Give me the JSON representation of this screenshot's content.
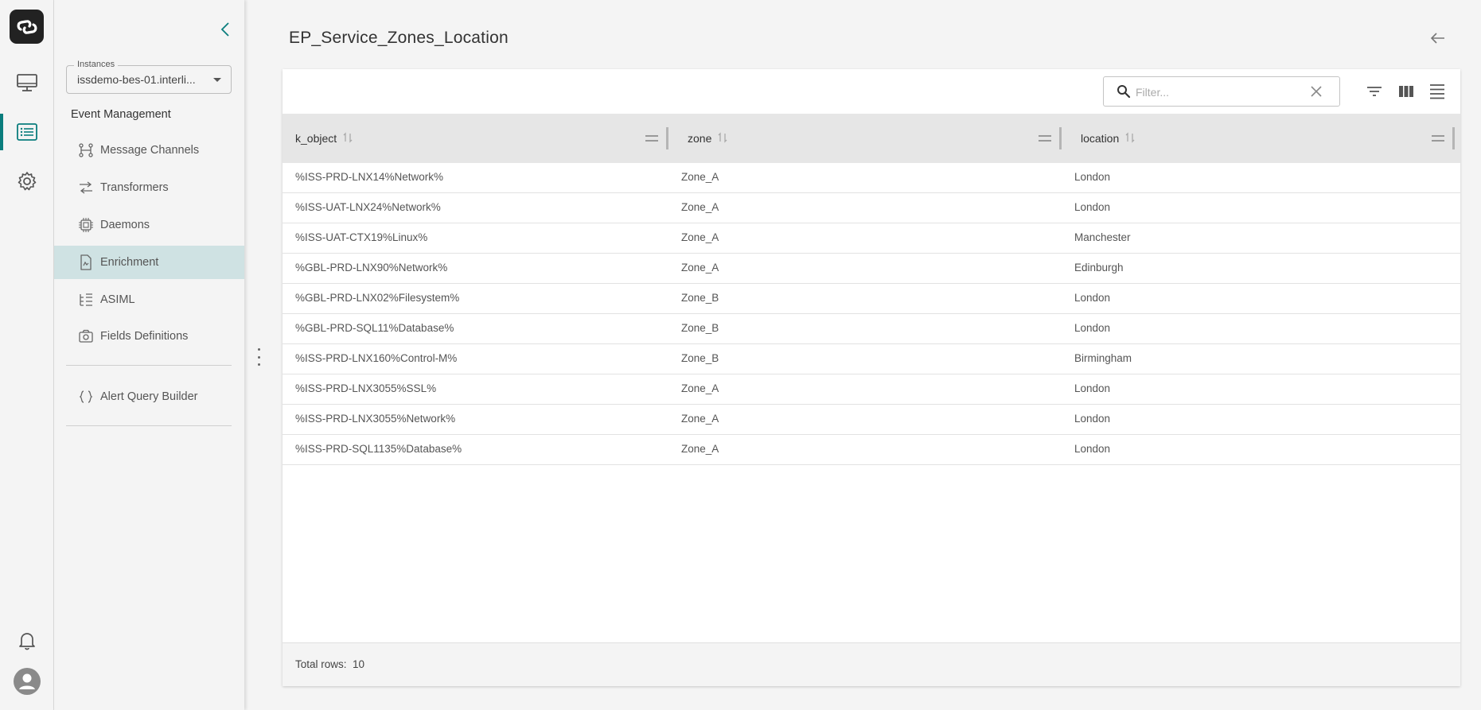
{
  "rail": {
    "logo_icon": "link-logo-icon",
    "items": [
      {
        "icon": "monitor-icon"
      },
      {
        "icon": "list-icon",
        "active": true
      },
      {
        "icon": "gear-icon"
      }
    ],
    "bottom": [
      {
        "icon": "bell-icon"
      },
      {
        "icon": "user-avatar-icon"
      }
    ]
  },
  "sidebar": {
    "instances_label": "Instances",
    "instances_value": "issdemo-bes-01.interli...",
    "section_title": "Event Management",
    "items": [
      {
        "label": "Message Channels",
        "icon": "message-channels-icon"
      },
      {
        "label": "Transformers",
        "icon": "transformers-icon"
      },
      {
        "label": "Daemons",
        "icon": "chip-icon"
      },
      {
        "label": "Enrichment",
        "icon": "enrichment-icon",
        "active": true
      },
      {
        "label": "ASIML",
        "icon": "asiml-icon"
      },
      {
        "label": "Fields Definitions",
        "icon": "fields-icon"
      }
    ],
    "extra_items": [
      {
        "label": "Alert Query Builder",
        "icon": "braces-icon"
      }
    ]
  },
  "main": {
    "title": "EP_Service_Zones_Location",
    "filter_placeholder": "Filter...",
    "columns": [
      "k_object",
      "zone",
      "location"
    ],
    "rows": [
      [
        "%ISS-PRD-LNX14%Network%",
        "Zone_A",
        "London"
      ],
      [
        "%ISS-UAT-LNX24%Network%",
        "Zone_A",
        "London"
      ],
      [
        "%ISS-UAT-CTX19%Linux%",
        "Zone_A",
        "Manchester"
      ],
      [
        "%GBL-PRD-LNX90%Network%",
        "Zone_A",
        "Edinburgh"
      ],
      [
        "%GBL-PRD-LNX02%Filesystem%",
        "Zone_B",
        "London"
      ],
      [
        "%GBL-PRD-SQL11%Database%",
        "Zone_B",
        "London"
      ],
      [
        "%ISS-PRD-LNX160%Control-M%",
        "Zone_B",
        "Birmingham"
      ],
      [
        "%ISS-PRD-LNX3055%SSL%",
        "Zone_A",
        "London"
      ],
      [
        "%ISS-PRD-LNX3055%Network%",
        "Zone_A",
        "London"
      ],
      [
        "%ISS-PRD-SQL1135%Database%",
        "Zone_A",
        "London"
      ]
    ],
    "footer_label": "Total rows:",
    "footer_count": "10"
  },
  "colors": {
    "accent": "#0a7d7d",
    "active_bg": "#cfe2e3"
  }
}
